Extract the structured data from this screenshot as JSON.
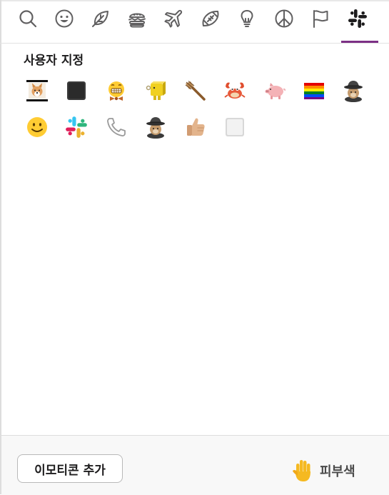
{
  "tabs": [
    {
      "icon": "search-icon"
    },
    {
      "icon": "smiley-icon"
    },
    {
      "icon": "leaf-icon"
    },
    {
      "icon": "burger-icon"
    },
    {
      "icon": "airplane-icon"
    },
    {
      "icon": "football-icon"
    },
    {
      "icon": "lightbulb-icon"
    },
    {
      "icon": "peace-icon"
    },
    {
      "icon": "flag-icon"
    },
    {
      "icon": "slack-icon",
      "selected": true
    }
  ],
  "accent_color": "#7c3085",
  "section": {
    "title": "사용자 지정"
  },
  "custom_emoji": [
    {
      "icon": "corgi-banner-emoji"
    },
    {
      "icon": "black-square-emoji"
    },
    {
      "icon": "grinning-bowtie-emoji"
    },
    {
      "icon": "yellow-block-emoji"
    },
    {
      "icon": "wooden-stick-emoji"
    },
    {
      "icon": "crab-emoji"
    },
    {
      "icon": "pig-emoji"
    },
    {
      "icon": "rainbow-flag-emoji"
    },
    {
      "icon": "detective-cat-emoji"
    },
    {
      "icon": "slightly-smiling-emoji"
    },
    {
      "icon": "slack-logo-emoji"
    },
    {
      "icon": "phone-receiver-emoji"
    },
    {
      "icon": "detective-cat-emoji"
    },
    {
      "icon": "thumbs-up-emoji"
    },
    {
      "icon": "white-square-emoji"
    }
  ],
  "footer": {
    "add_label": "이모티콘 추가",
    "skin_label": "피부색",
    "skin_icon": "raised-hand-icon"
  }
}
